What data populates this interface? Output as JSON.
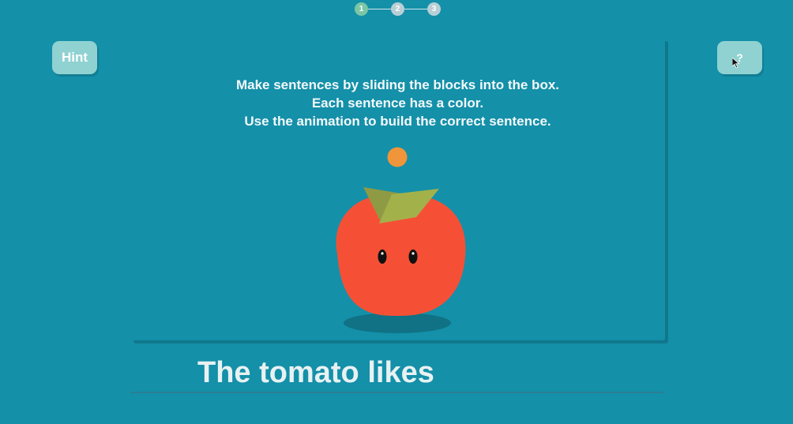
{
  "progress": {
    "steps": [
      "1",
      "2",
      "3"
    ],
    "current": 1
  },
  "buttons": {
    "hint_label": "Hint",
    "help_label": "?"
  },
  "instructions": [
    "Make sentences by sliding the blocks into the box.",
    "Each sentence has a color.",
    "Use the animation to build the correct sentence."
  ],
  "animation": {
    "character": "tomato-icon",
    "ball_color": "#f0953a",
    "tomato_color": "#f55036",
    "leaf_color": "#9aa849"
  },
  "sentence": {
    "text": "The tomato likes"
  },
  "colors": {
    "background": "#1490a9",
    "button": "#8fd2d1",
    "step_active": "#7cc6a6"
  }
}
